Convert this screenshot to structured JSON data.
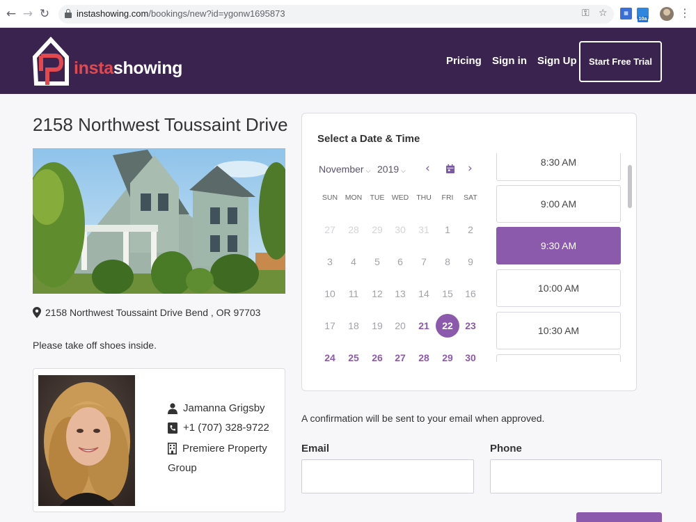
{
  "browser": {
    "url_host": "instashowing.com",
    "url_path": "/bookings/new?id=ygonw1695873",
    "ext_badge": "10a"
  },
  "header": {
    "brand_part1": "insta",
    "brand_part2": "showing",
    "nav": [
      "Pricing",
      "Sign in",
      "Sign Up"
    ],
    "cta": "Start Free Trial",
    "colors": {
      "header_bg": "#3b2350",
      "brand_red": "#e2494e",
      "accent_purple": "#8b5aad"
    }
  },
  "listing": {
    "title": "2158 Northwest Toussaint Drive",
    "address": "2158 Northwest Toussaint Drive Bend , OR 97703",
    "note": "Please take off shoes inside."
  },
  "agent": {
    "name": "Jamanna Grigsby",
    "phone": "+1 (707) 328-9722",
    "company_line1": "Premiere Property",
    "company_line2": "Group"
  },
  "booking": {
    "title": "Select a Date & Time",
    "month": "November",
    "year": "2019",
    "weekdays": [
      "SUN",
      "MON",
      "TUE",
      "WED",
      "THU",
      "FRI",
      "SAT"
    ],
    "weeks": [
      [
        {
          "d": "27",
          "s": "faded"
        },
        {
          "d": "28",
          "s": "faded"
        },
        {
          "d": "29",
          "s": "faded"
        },
        {
          "d": "30",
          "s": "faded"
        },
        {
          "d": "31",
          "s": "faded"
        },
        {
          "d": "1",
          "s": "muted"
        },
        {
          "d": "2",
          "s": "muted"
        }
      ],
      [
        {
          "d": "3",
          "s": "muted"
        },
        {
          "d": "4",
          "s": "muted"
        },
        {
          "d": "5",
          "s": "muted"
        },
        {
          "d": "6",
          "s": "muted"
        },
        {
          "d": "7",
          "s": "muted"
        },
        {
          "d": "8",
          "s": "muted"
        },
        {
          "d": "9",
          "s": "muted"
        }
      ],
      [
        {
          "d": "10",
          "s": "muted"
        },
        {
          "d": "11",
          "s": "muted"
        },
        {
          "d": "12",
          "s": "muted"
        },
        {
          "d": "13",
          "s": "muted"
        },
        {
          "d": "14",
          "s": "muted"
        },
        {
          "d": "15",
          "s": "muted"
        },
        {
          "d": "16",
          "s": "muted"
        }
      ],
      [
        {
          "d": "17",
          "s": "muted"
        },
        {
          "d": "18",
          "s": "muted"
        },
        {
          "d": "19",
          "s": "muted"
        },
        {
          "d": "20",
          "s": "muted"
        },
        {
          "d": "21",
          "s": "avail"
        },
        {
          "d": "22",
          "s": "selected"
        },
        {
          "d": "23",
          "s": "avail"
        }
      ],
      [
        {
          "d": "24",
          "s": "avail"
        },
        {
          "d": "25",
          "s": "avail"
        },
        {
          "d": "26",
          "s": "avail"
        },
        {
          "d": "27",
          "s": "avail"
        },
        {
          "d": "28",
          "s": "avail"
        },
        {
          "d": "29",
          "s": "avail"
        },
        {
          "d": "30",
          "s": "avail"
        }
      ]
    ],
    "slots": [
      {
        "label": "8:30 AM",
        "selected": false
      },
      {
        "label": "9:00 AM",
        "selected": false
      },
      {
        "label": "9:30 AM",
        "selected": true
      },
      {
        "label": "10:00 AM",
        "selected": false
      },
      {
        "label": "10:30 AM",
        "selected": false
      },
      {
        "label": "",
        "selected": false
      }
    ]
  },
  "form": {
    "confirmation": "A confirmation will be sent to your email when approved.",
    "email_label": "Email",
    "phone_label": "Phone",
    "email_value": "",
    "phone_value": ""
  }
}
